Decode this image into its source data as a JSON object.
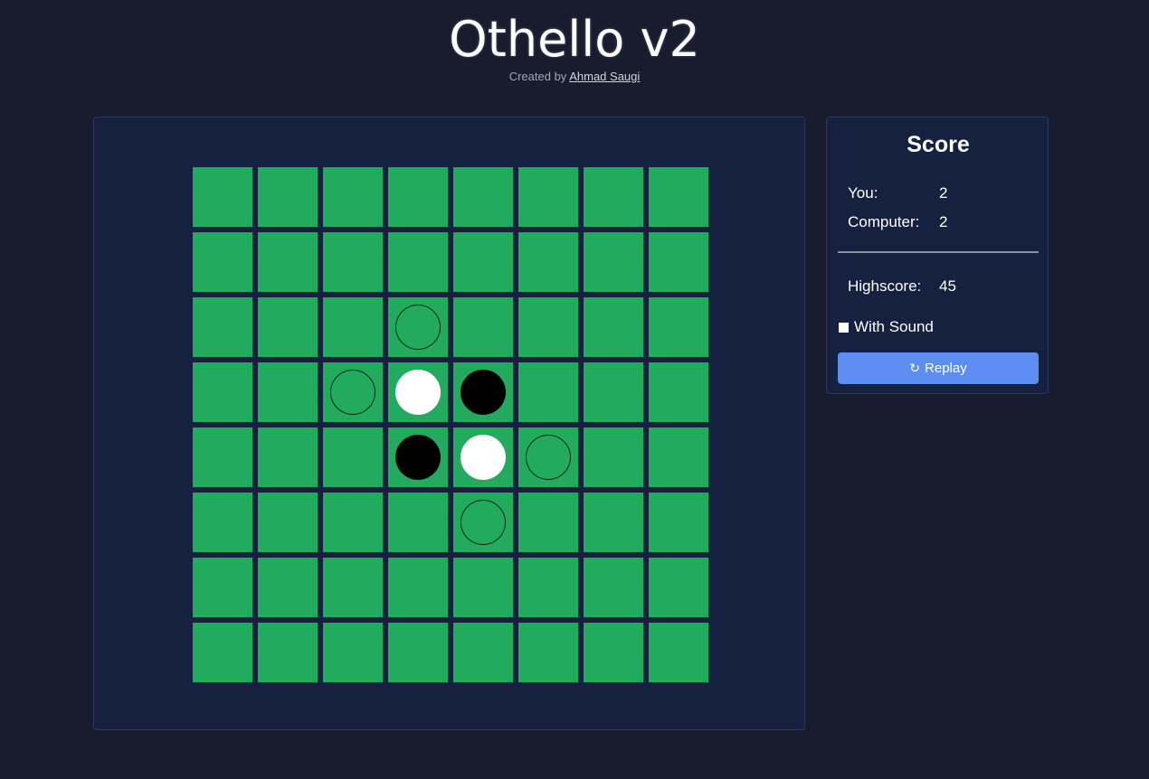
{
  "header": {
    "title": "Othello v2",
    "credit_prefix": "Created by",
    "author": "Ahmad Saugi"
  },
  "board": {
    "size": 8,
    "cell_color": "#22aa5e",
    "pieces": [
      {
        "row": 2,
        "col": 3,
        "kind": "hint"
      },
      {
        "row": 3,
        "col": 2,
        "kind": "hint"
      },
      {
        "row": 3,
        "col": 3,
        "kind": "white"
      },
      {
        "row": 3,
        "col": 4,
        "kind": "black"
      },
      {
        "row": 4,
        "col": 3,
        "kind": "black"
      },
      {
        "row": 4,
        "col": 4,
        "kind": "white"
      },
      {
        "row": 4,
        "col": 5,
        "kind": "hint"
      },
      {
        "row": 5,
        "col": 4,
        "kind": "hint"
      }
    ]
  },
  "score": {
    "title": "Score",
    "you_label": "You:",
    "you_value": "2",
    "computer_label": "Computer:",
    "computer_value": "2",
    "highscore_label": "Highscore:",
    "highscore_value": "45",
    "sound_label": "With Sound",
    "replay_label": "Replay",
    "replay_icon": "refresh-icon"
  },
  "colors": {
    "background": "#191b2e",
    "panel": "#15213e",
    "button": "#5b8ef0"
  }
}
